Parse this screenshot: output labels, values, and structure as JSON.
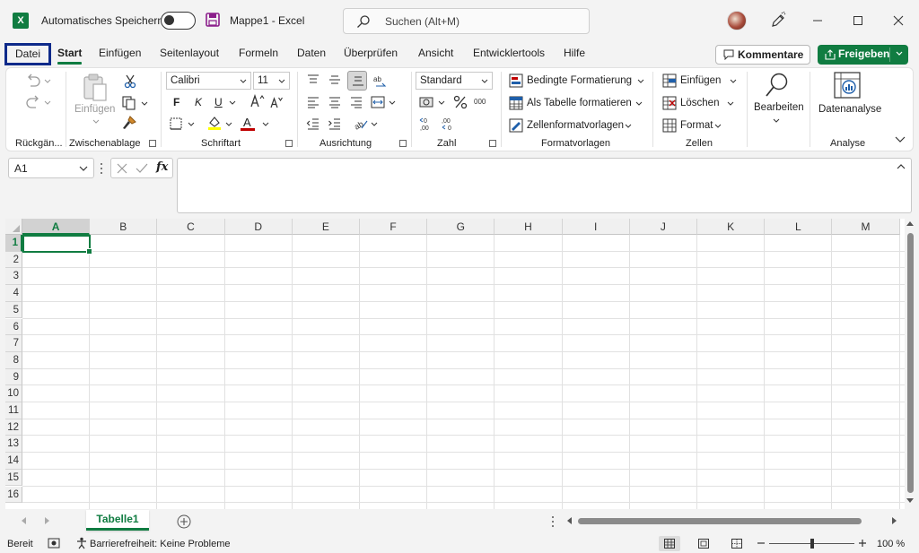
{
  "titlebar": {
    "autosave_label": "Automatisches Speichern",
    "doc_title": "Mappe1  -  Excel",
    "search_placeholder": "Suchen (Alt+M)"
  },
  "tabs": [
    "Start",
    "Einfügen",
    "Seitenlayout",
    "Formeln",
    "Daten",
    "Überprüfen",
    "Ansicht",
    "Entwicklertools",
    "Hilfe"
  ],
  "file_tab": "Datei",
  "actions": {
    "comment": "Kommentare",
    "share": "Freigeben"
  },
  "ribbon": {
    "paste_label": "Einfügen",
    "font_name": "Calibri",
    "font_size": "11",
    "number_format": "Standard",
    "bold": "F",
    "italic": "K",
    "underline": "U",
    "font_color_letter": "A",
    "styles": {
      "conditional": "Bedingte Formatierung",
      "as_table": "Als Tabelle formatieren",
      "cell_styles": "Zellenformatvorlagen"
    },
    "cells": {
      "insert": "Einfügen",
      "delete": "Löschen",
      "format": "Format"
    },
    "edit_label": "Bearbeiten",
    "analyze_label": "Datenanalyse",
    "groups": {
      "undo": "Rückgän...",
      "clipboard": "Zwischenablage",
      "font": "Schriftart",
      "alignment": "Ausrichtung",
      "number": "Zahl",
      "styles": "Formatvorlagen",
      "cells": "Zellen",
      "analysis": "Analyse"
    },
    "colors": {
      "highlight": "#ffff00",
      "font": "#c00000"
    }
  },
  "formula_bar": {
    "namebox": "A1",
    "fx": "fx",
    "value": ""
  },
  "grid": {
    "columns": [
      "A",
      "B",
      "C",
      "D",
      "E",
      "F",
      "G",
      "H",
      "I",
      "J",
      "K",
      "L",
      "M"
    ],
    "rows": [
      "1",
      "2",
      "3",
      "4",
      "5",
      "6",
      "7",
      "8",
      "9",
      "10",
      "11",
      "12",
      "13",
      "14",
      "15",
      "16"
    ],
    "active_cell": "A1"
  },
  "sheets": [
    "Tabelle1"
  ],
  "status": {
    "ready": "Bereit",
    "accessibility": "Barrierefreiheit: Keine Probleme",
    "zoom": "100 %"
  },
  "theme": {
    "accent": "#107c41",
    "file_highlight": "#0e2a8a"
  }
}
